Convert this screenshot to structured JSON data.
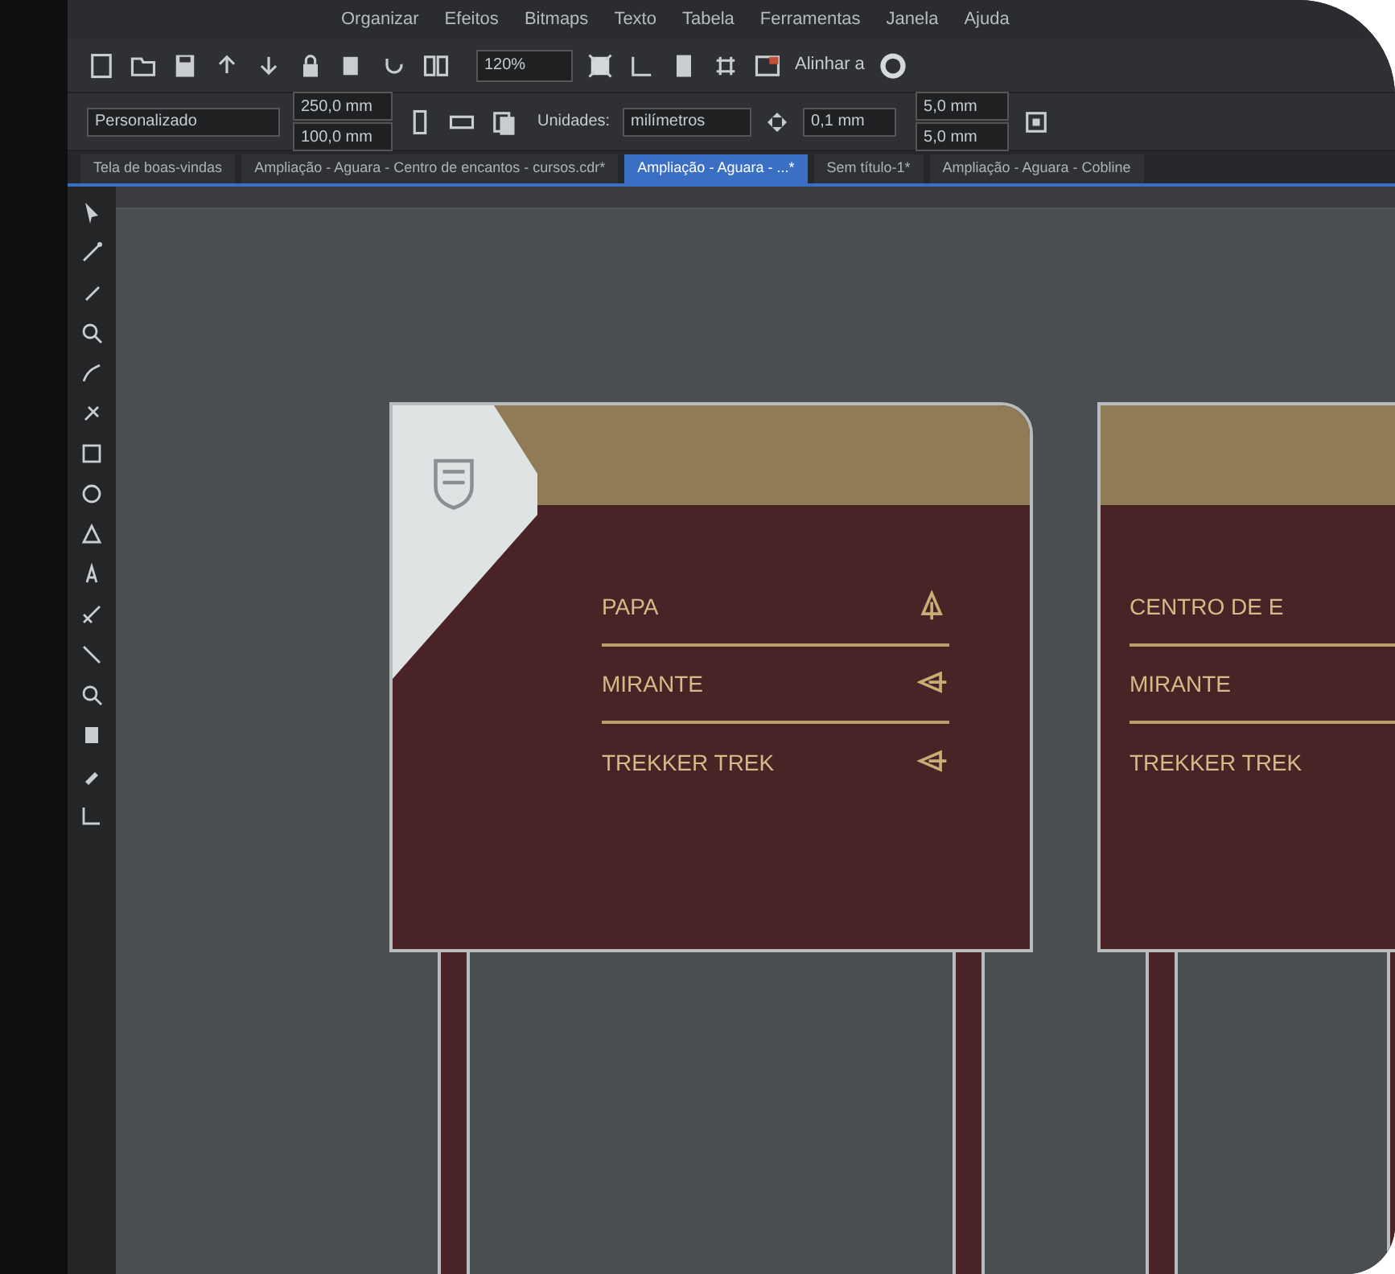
{
  "menu": [
    "Organizar",
    "Efeitos",
    "Bitmaps",
    "Texto",
    "Tabela",
    "Ferramentas",
    "Janela",
    "Ajuda"
  ],
  "toolbar": {
    "zoom": "120%",
    "snap": "Alinhar a"
  },
  "property_bar": {
    "page_size": "Personalizado",
    "width": "250,0 mm",
    "height": "100,0 mm",
    "units_label": "Unidades:",
    "units": "milímetros",
    "nudge": "0,1 mm",
    "duplicate_x": "5,0 mm",
    "duplicate_y": "5,0 mm"
  },
  "tabs": [
    {
      "label": "Tela de boas-vindas",
      "selected": false
    },
    {
      "label": "Ampliação - Aguara - Centro de encantos - cursos.cdr*",
      "selected": false
    },
    {
      "label": "Ampliação - Aguara - ...*",
      "selected": true
    },
    {
      "label": "Sem título-1*",
      "selected": false
    },
    {
      "label": "Ampliação - Aguara - Cobline",
      "selected": false
    }
  ],
  "signs": [
    {
      "logo": true,
      "rows": [
        {
          "label": "PAPA",
          "kind": "up"
        },
        {
          "label": "MIRANTE",
          "kind": "left"
        },
        {
          "label": "TREKKER TREK",
          "kind": "left"
        }
      ]
    },
    {
      "logo": false,
      "rows": [
        {
          "label": "CENTRO DE E",
          "kind": "none"
        },
        {
          "label": "MIRANTE",
          "kind": "none"
        },
        {
          "label": "TREKKER TREK",
          "kind": "none"
        }
      ]
    }
  ]
}
